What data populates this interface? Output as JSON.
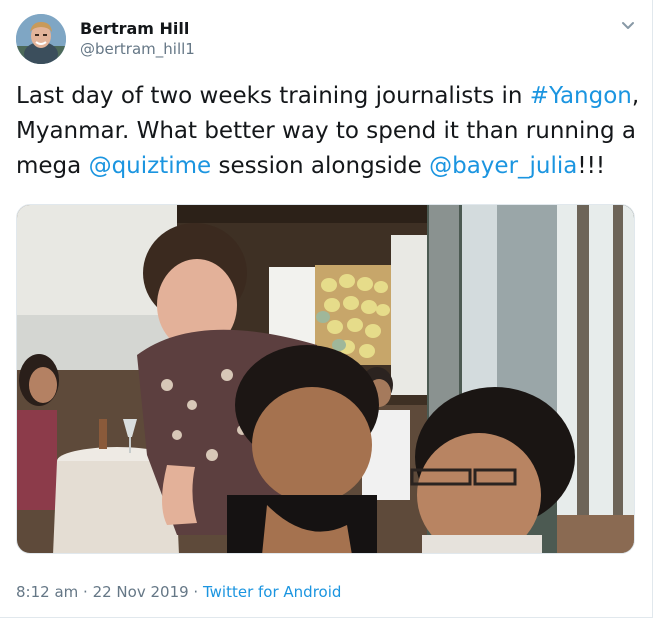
{
  "author": {
    "name": "Bertram Hill",
    "handle": "@bertram_hill1"
  },
  "tweet": {
    "text_1": "Last day of two weeks training journalists in ",
    "hashtag": "#Yangon",
    "text_2": ", Myanmar. What better way to spend it than running a mega ",
    "mention_1": "@quiztime",
    "text_3": " session alongside ",
    "mention_2": "@bayer_julia",
    "text_4": "!!!"
  },
  "meta": {
    "time": "8:12 am",
    "separator_1": " · ",
    "date": "22 Nov 2019",
    "separator_2": " · ",
    "source": "Twitter for Android"
  },
  "photo": {
    "alt": "Photo of a training room: a woman leaning over two men at a table, whiteboard with sticky notes behind them"
  },
  "icons": {
    "caret": "chevron-down-icon",
    "avatar": "user-avatar"
  },
  "colors": {
    "link": "#1b95e0",
    "text": "#14171a",
    "secondary": "#657786",
    "border": "#e1e8ed"
  }
}
